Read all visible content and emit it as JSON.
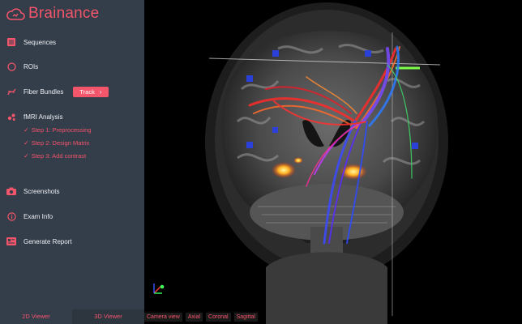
{
  "brand": {
    "name": "Brainance",
    "accent": "#f3556a",
    "logo_icon": "cloud-icon"
  },
  "sidebar": {
    "items": [
      {
        "id": "sequences",
        "label": "Sequences",
        "icon": "list-icon"
      },
      {
        "id": "rois",
        "label": "ROIs",
        "icon": "circle-icon"
      },
      {
        "id": "fiber-bundles",
        "label": "Fiber Bundles",
        "icon": "fiber-icon"
      },
      {
        "id": "fmri-analysis",
        "label": "fMRI Analysis",
        "icon": "dots-icon"
      },
      {
        "id": "screenshots",
        "label": "Screenshots",
        "icon": "camera-icon"
      },
      {
        "id": "exam-info",
        "label": "Exam Info",
        "icon": "info-icon"
      },
      {
        "id": "generate-report",
        "label": "Generate Report",
        "icon": "report-icon"
      }
    ],
    "track_button": "Track",
    "steps": [
      {
        "label": "Step 1: Preprocessing"
      },
      {
        "label": "Step 2: Design Matrix"
      },
      {
        "label": "Step 3: Add contrast"
      }
    ],
    "viewer_tabs": [
      {
        "label": "2D Viewer"
      },
      {
        "label": "3D Viewer",
        "active": true
      }
    ]
  },
  "view_tabs": [
    {
      "label": "Camera view"
    },
    {
      "label": "Axial"
    },
    {
      "label": "Coronal"
    },
    {
      "label": "Sagittal"
    }
  ],
  "colors": {
    "sidebar_bg": "#343d4a",
    "text": "#eef1f4",
    "accent": "#f3556a"
  }
}
